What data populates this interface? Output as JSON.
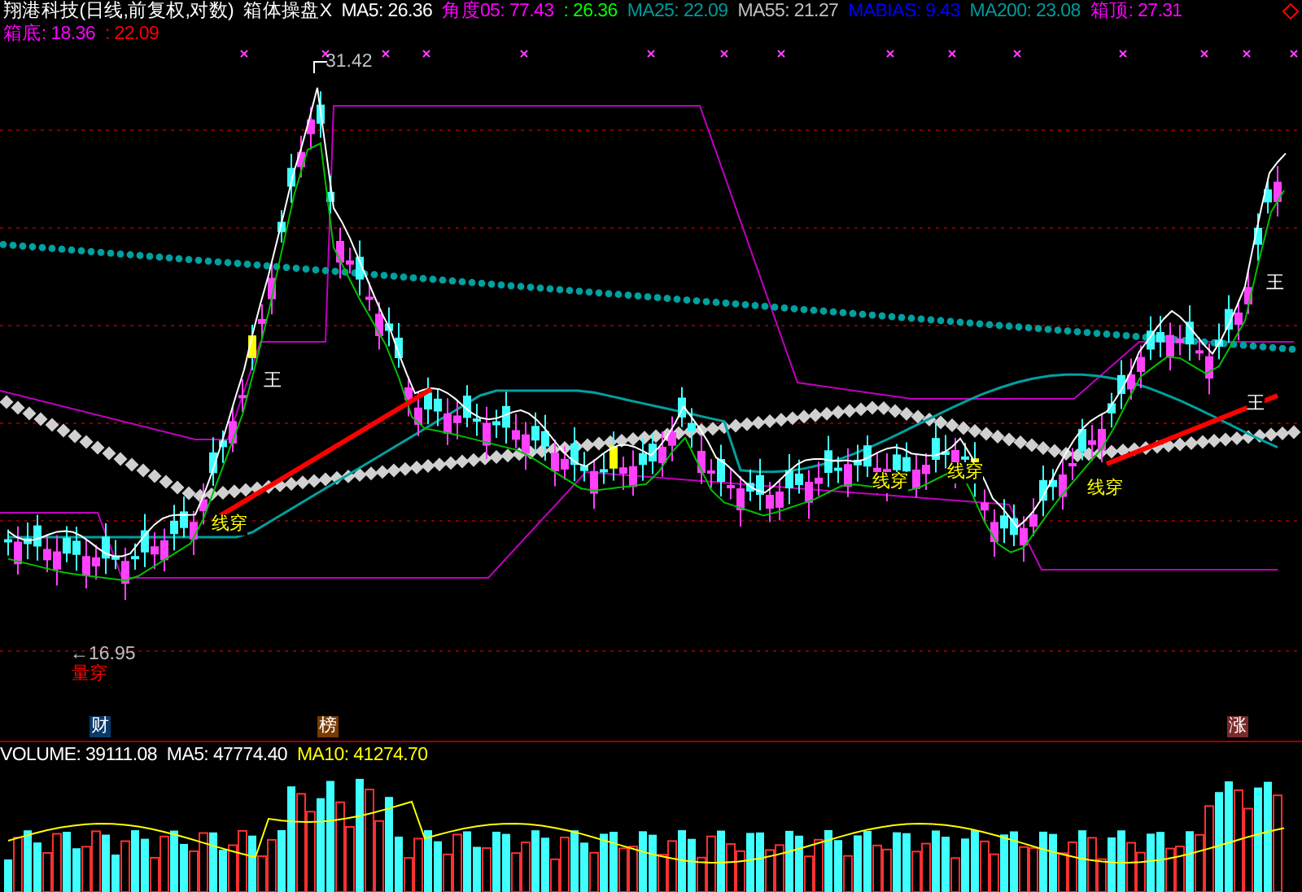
{
  "header": {
    "line_1": [
      {
        "text": "翔港科技(日线,前复权,对数)",
        "color": "#ffffff"
      },
      {
        "text": "箱体操盘X",
        "color": "#ffffff"
      },
      {
        "text": "MA5: 26.36",
        "color": "#ffffff"
      },
      {
        "text": "角度05: 77.43",
        "color": "#ff00ff"
      },
      {
        "text": ": 26.36",
        "color": "#00ff00"
      },
      {
        "text": "MA25: 22.09",
        "color": "#009a9a"
      },
      {
        "text": "MA55: 21.27",
        "color": "#c0c0c0"
      },
      {
        "text": "MABIAS: 9.43",
        "color": "#0000ff"
      },
      {
        "text": "MA200: 23.08",
        "color": "#009a9a"
      },
      {
        "text": "箱顶: 27.31",
        "color": "#ff00ff"
      }
    ],
    "line_2": [
      {
        "text": "箱底: 18.36",
        "color": "#ff00ff"
      },
      {
        "text": ": 22.09",
        "color": "#ff0000"
      }
    ]
  },
  "price_labels": [
    "31.42",
    "←16.95"
  ],
  "signals": [
    {
      "text": "王",
      "kind": "king"
    },
    {
      "text": "王",
      "kind": "king"
    },
    {
      "text": "王",
      "kind": "king"
    },
    {
      "text": "线穿",
      "kind": "line"
    },
    {
      "text": "线穿",
      "kind": "line"
    },
    {
      "text": "线穿",
      "kind": "line"
    },
    {
      "text": "线穿",
      "kind": "line"
    },
    {
      "text": "量穿",
      "kind": "volume"
    }
  ],
  "events": [
    {
      "text": "财",
      "color": "#0a3a6a"
    },
    {
      "text": "榜",
      "color": "#7a3a00"
    },
    {
      "text": "涨",
      "color": "#7a2a2a"
    }
  ],
  "volume_header": [
    {
      "text": "VOLUME: 39111.08",
      "color": "#ffffff"
    },
    {
      "text": "MA5: 47774.40",
      "color": "#ffffff"
    },
    {
      "text": "MA10: 41274.70",
      "color": "#ffff00"
    }
  ]
}
